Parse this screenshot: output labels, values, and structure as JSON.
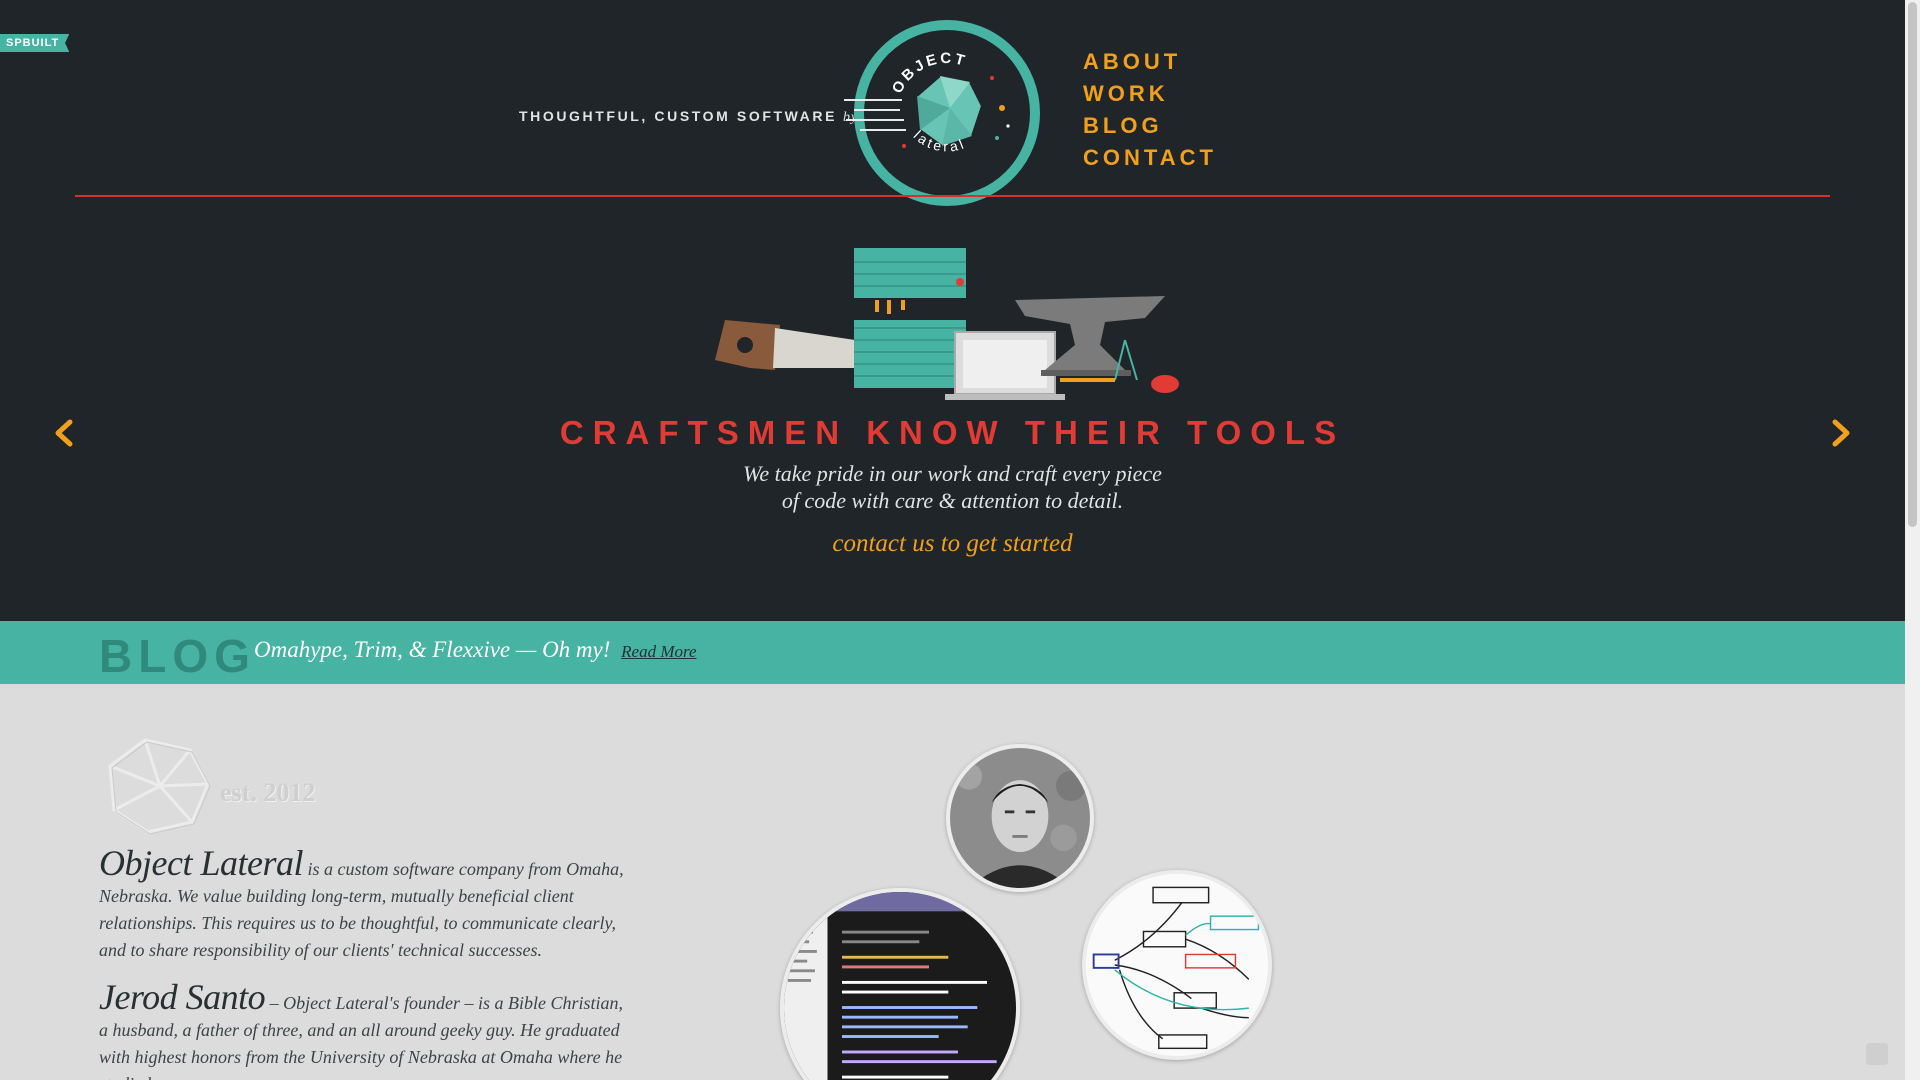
{
  "badge": "SPBUILT",
  "header": {
    "tagline": "THOUGHTFUL, CUSTOM SOFTWARE",
    "tagline_by": "by",
    "logo_top": "OBJECT",
    "logo_bottom": "lateral",
    "nav": [
      "ABOUT",
      "WORK",
      "BLOG",
      "CONTACT"
    ]
  },
  "hero": {
    "title": "CRAFTSMEN KNOW THEIR TOOLS",
    "line1": "We take pride in our work and craft every piece",
    "line2": "of code with care & attention to detail.",
    "cta": "contact us to get started"
  },
  "blog": {
    "label": "BLOG",
    "post_title": "Omahype, Trim, & Flexxive — Oh my!",
    "read_more": "Read More"
  },
  "about": {
    "est": "est. 2012",
    "company_name": "Object Lateral",
    "company_text": "is a custom software company from Omaha, Nebraska. We value building long-term, mutually beneficial client relationships. This requires us to be thoughtful, to communicate clearly, and to share responsibility of our clients' technical successes.",
    "founder_name": "Jerod Santo",
    "founder_text": "– Object Lateral's founder – is a Bible Christian, a husband, a father of three, and an all around geeky guy. He graduated with highest honors from the University of Nebraska at Omaha where he studied"
  },
  "colors": {
    "background": "#1f2528",
    "accent_orange": "#f2a01b",
    "accent_red": "#e03b34",
    "teal": "#47b3a2"
  }
}
